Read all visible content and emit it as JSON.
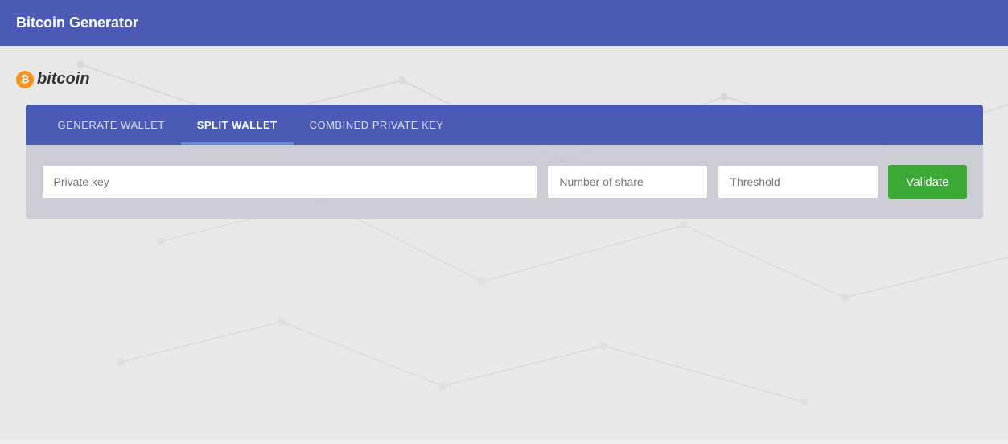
{
  "header": {
    "title": "Bitcoin Generator"
  },
  "bitcoin_logo": {
    "icon_symbol": "₿",
    "text": "bitcoin"
  },
  "tabs": {
    "items": [
      {
        "id": "generate-wallet",
        "label": "GENERATE WALLET",
        "active": false
      },
      {
        "id": "split-wallet",
        "label": "SPLIT WALLET",
        "active": true
      },
      {
        "id": "combined-private-key",
        "label": "COMBINED PRIVATE KEY",
        "active": false
      }
    ]
  },
  "form": {
    "private_key_placeholder": "Private key",
    "number_of_share_placeholder": "Number of share",
    "threshold_placeholder": "Threshold",
    "validate_label": "Validate"
  }
}
